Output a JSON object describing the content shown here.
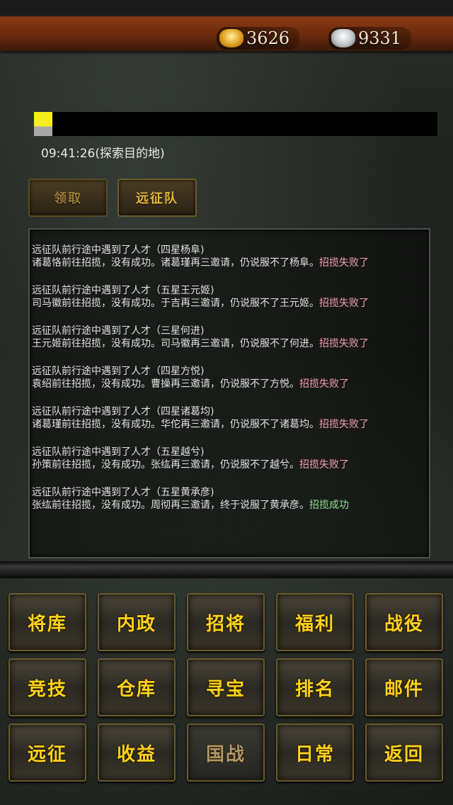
{
  "currency": {
    "gold_value": "3626",
    "silver_value": "9331"
  },
  "status": {
    "timer": "09:41:26(探索目的地)"
  },
  "actions": {
    "claim_label": "领取",
    "expedition_label": "远征队"
  },
  "log": [
    {
      "line1": "远征队前行途中遇到了人才（四星杨阜)",
      "line2": "诸葛恪前往招揽，没有成功。诸葛瑾再三邀请，仍说服不了杨阜。",
      "result": "招揽失败了",
      "success": false
    },
    {
      "line1": "远征队前行途中遇到了人才（五星王元姬)",
      "line2": "司马徽前往招揽，没有成功。于吉再三邀请，仍说服不了王元姬。",
      "result": "招揽失败了",
      "success": false
    },
    {
      "line1": "远征队前行途中遇到了人才（三星何进)",
      "line2": "王元姬前往招揽，没有成功。司马徽再三邀请，仍说服不了何进。",
      "result": "招揽失败了",
      "success": false
    },
    {
      "line1": "远征队前行途中遇到了人才（四星方悦)",
      "line2": "袁绍前往招揽，没有成功。曹操再三邀请，仍说服不了方悦。",
      "result": "招揽失败了",
      "success": false
    },
    {
      "line1": "远征队前行途中遇到了人才（四星诸葛均)",
      "line2": "诸葛瑾前往招揽，没有成功。华佗再三邀请，仍说服不了诸葛均。",
      "result": "招揽失败了",
      "success": false
    },
    {
      "line1": "远征队前行途中遇到了人才（五星越兮)",
      "line2": "孙策前往招揽，没有成功。张纮再三邀请，仍说服不了越兮。",
      "result": "招揽失败了",
      "success": false
    },
    {
      "line1": "远征队前行途中遇到了人才（五星黄承彦)",
      "line2": "张纮前往招揽，没有成功。周彻再三邀请，终于说服了黄承彦。",
      "result": "招揽成功",
      "success": true
    }
  ],
  "menu": [
    {
      "label": "将库",
      "name": "menu-generals"
    },
    {
      "label": "内政",
      "name": "menu-internal"
    },
    {
      "label": "招将",
      "name": "menu-recruit"
    },
    {
      "label": "福利",
      "name": "menu-welfare"
    },
    {
      "label": "战役",
      "name": "menu-campaign"
    },
    {
      "label": "竞技",
      "name": "menu-arena"
    },
    {
      "label": "仓库",
      "name": "menu-warehouse"
    },
    {
      "label": "寻宝",
      "name": "menu-treasure"
    },
    {
      "label": "排名",
      "name": "menu-ranking"
    },
    {
      "label": "邮件",
      "name": "menu-mail"
    },
    {
      "label": "远征",
      "name": "menu-expedition"
    },
    {
      "label": "收益",
      "name": "menu-income"
    },
    {
      "label": "国战",
      "name": "menu-national-war",
      "dim": true
    },
    {
      "label": "日常",
      "name": "menu-daily"
    },
    {
      "label": "返回",
      "name": "menu-back"
    }
  ]
}
